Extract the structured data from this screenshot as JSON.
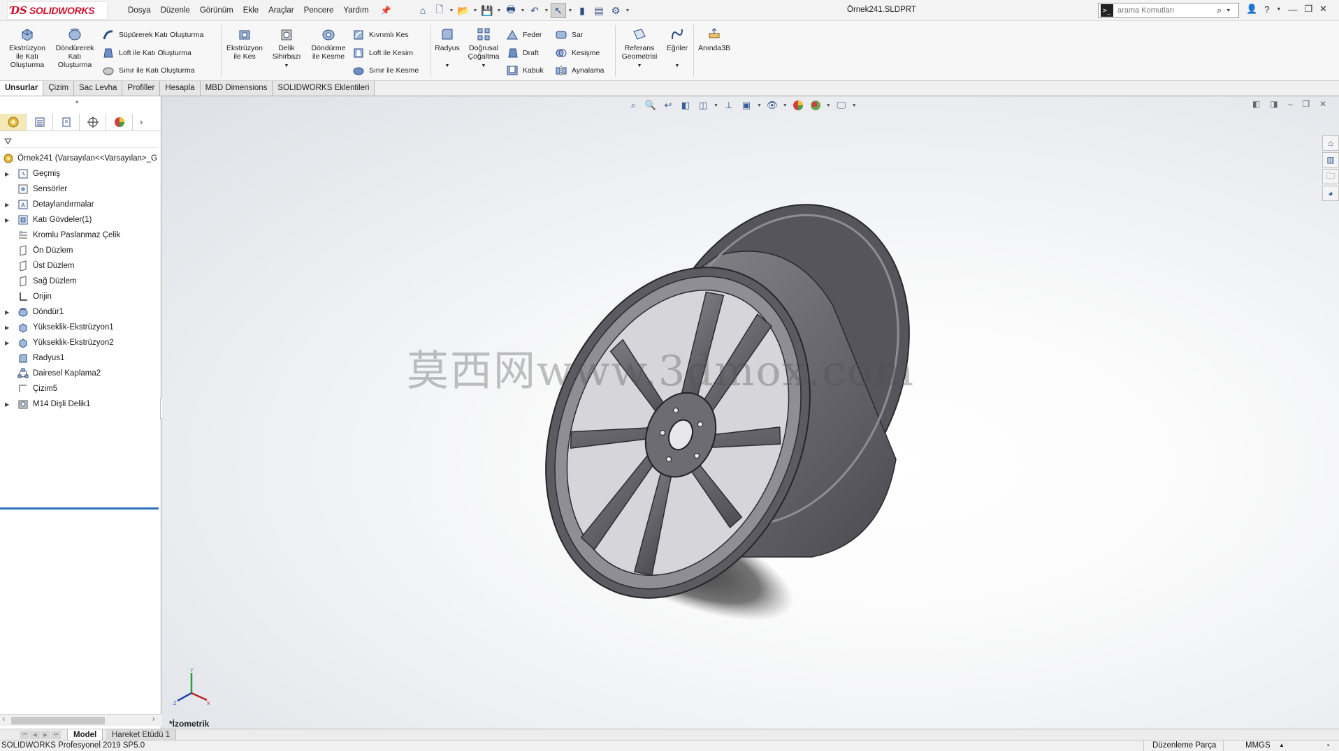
{
  "app": {
    "logo_text": "SOLIDWORKS",
    "document_title": "Örnek241.SLDPRT",
    "menu": [
      "Dosya",
      "Düzenle",
      "Görünüm",
      "Ekle",
      "Araçlar",
      "Pencere",
      "Yardım"
    ],
    "search_placeholder": "arama Komutları"
  },
  "ribbon": {
    "extrude_boss": "Ekstrüzyon ile Katı Oluşturma",
    "revolve_boss": "Döndürerek Katı Oluşturma",
    "swept_boss": "Süpürerek Katı Oluşturma",
    "loft_boss": "Loft ile Katı Oluşturma",
    "boundary_boss": "Sınır ile Katı Oluşturma",
    "extrude_cut": "Ekstrüzyon ile Kes",
    "hole_wizard": "Delik Sihirbazı",
    "revolve_cut": "Döndürme ile Kesme",
    "swept_cut": "Kıvrımlı Kes",
    "loft_cut": "Loft ile Kesim",
    "boundary_cut": "Sınır ile Kesme",
    "fillet": "Radyus",
    "linear_pattern": "Doğrusal Çoğaltma",
    "rib": "Feder",
    "draft": "Draft",
    "shell": "Kabuk",
    "wrap": "Sar",
    "intersect": "Kesişme",
    "mirror": "Aynalama",
    "ref_geometry": "Referans Geometrisi",
    "curves": "Eğriler",
    "instant3d": "Anında3B"
  },
  "command_tabs": [
    "Unsurlar",
    "Çizim",
    "Sac Levha",
    "Profiller",
    "Hesapla",
    "MBD Dimensions",
    "SOLIDWORKS Eklentileri"
  ],
  "feature_tree": {
    "root": "Örnek241  (Varsayılan<<Varsayılan>_G",
    "items": [
      {
        "label": "Geçmiş",
        "icon": "history-icon",
        "expandable": true
      },
      {
        "label": "Sensörler",
        "icon": "sensor-icon",
        "expandable": false
      },
      {
        "label": "Detaylandırmalar",
        "icon": "annotation-icon",
        "expandable": true
      },
      {
        "label": "Katı Gövdeler(1)",
        "icon": "solid-bodies-icon",
        "expandable": true
      },
      {
        "label": "Kromlu Paslanmaz Çelik",
        "icon": "material-icon",
        "expandable": false
      },
      {
        "label": "Ön Düzlem",
        "icon": "plane-icon",
        "expandable": false
      },
      {
        "label": "Üst Düzlem",
        "icon": "plane-icon",
        "expandable": false
      },
      {
        "label": "Sağ Düzlem",
        "icon": "plane-icon",
        "expandable": false
      },
      {
        "label": "Orijin",
        "icon": "origin-icon",
        "expandable": false
      },
      {
        "label": "Döndür1",
        "icon": "revolve-feature-icon",
        "expandable": true
      },
      {
        "label": "Yükseklik-Ekstrüzyon1",
        "icon": "extrude-feature-icon",
        "expandable": true
      },
      {
        "label": "Yükseklik-Ekstrüzyon2",
        "icon": "extrude-feature-icon",
        "expandable": true
      },
      {
        "label": "Radyus1",
        "icon": "fillet-feature-icon",
        "expandable": false
      },
      {
        "label": "Dairesel Kaplama2",
        "icon": "circular-pattern-icon",
        "expandable": false
      },
      {
        "label": "Çizim5",
        "icon": "sketch-icon",
        "expandable": false
      },
      {
        "label": "M14 Dişli Delik1",
        "icon": "hole-feature-icon",
        "expandable": true
      }
    ]
  },
  "viewport": {
    "watermark": "莫西网www.3dmox.com",
    "view_name": "*İzometrik"
  },
  "bottom_tabs": [
    "Model",
    "Hareket Etüdü 1"
  ],
  "status": {
    "product": "SOLIDWORKS Profesyonel 2019 SP5.0",
    "mode": "Düzenleme Parça",
    "units": "MMGS"
  }
}
